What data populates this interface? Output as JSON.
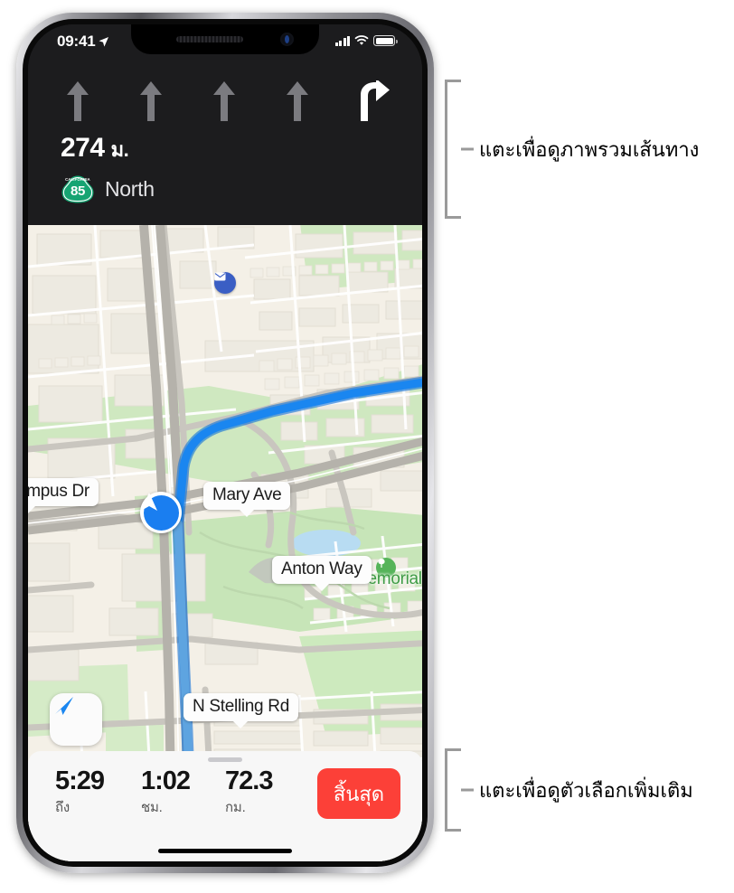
{
  "status_bar": {
    "time": "09:41",
    "location_arrow_icon": "location-arrow-icon",
    "signal_icon": "cellular-signal-icon",
    "wifi_icon": "wifi-icon",
    "battery_icon": "battery-full-icon"
  },
  "nav_banner": {
    "lanes": [
      {
        "icon": "lane-straight-icon",
        "state": "inactive"
      },
      {
        "icon": "lane-straight-icon",
        "state": "inactive"
      },
      {
        "icon": "lane-straight-icon",
        "state": "inactive"
      },
      {
        "icon": "lane-straight-icon",
        "state": "inactive"
      },
      {
        "icon": "lane-turn-right-icon",
        "state": "active"
      }
    ],
    "distance_value": "274",
    "distance_unit": "ม.",
    "shield_state": "CALIFORNIA",
    "shield_number": "85",
    "road_name": "North",
    "background_color": "#1c1c1e"
  },
  "map": {
    "callouts": [
      {
        "label": "ampus Dr"
      },
      {
        "label": "Mary Ave"
      },
      {
        "label": "Anton Way"
      },
      {
        "label": "N Stelling Rd"
      }
    ],
    "park_label": "Memorial Par",
    "mail_poi_icon": "mail-pin-icon",
    "park_poi_icon": "park-pin-icon",
    "location_puck_icon": "navigation-puck-icon",
    "tracking_button_icon": "navigation-arrow-icon",
    "route_color": "#1a86f0"
  },
  "bottom_sheet": {
    "grabber_icon": "drag-handle-icon",
    "stats": [
      {
        "value": "5:29",
        "label": "ถึง"
      },
      {
        "value": "1:02",
        "label": "ชม."
      },
      {
        "value": "72.3",
        "label": "กม."
      }
    ],
    "end_button_label": "สิ้นสุด",
    "end_button_color": "#fc4038",
    "home_indicator_icon": "home-indicator-icon"
  },
  "annotations": [
    {
      "text": "แตะเพื่อดูภาพรวมเส้นทาง"
    },
    {
      "text": "แตะเพื่อดูตัวเลือกเพิ่มเติม"
    }
  ]
}
